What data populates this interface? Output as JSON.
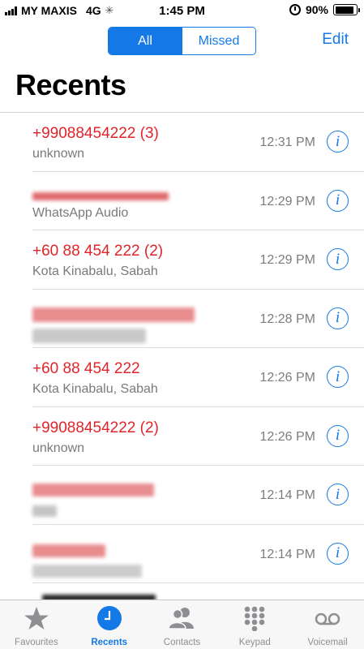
{
  "status_bar": {
    "carrier": "MY MAXIS",
    "network": "4G",
    "time": "1:45 PM",
    "battery": "90%",
    "battery_level": 0.9
  },
  "header": {
    "segments": [
      "All",
      "Missed"
    ],
    "selected_segment": "All",
    "edit_label": "Edit",
    "title": "Recents"
  },
  "calls": [
    {
      "caller": "+99088454222 (3)",
      "subtitle": "unknown",
      "time": "12:31 PM",
      "redacted": false
    },
    {
      "caller": "",
      "subtitle": "WhatsApp Audio",
      "time": "12:29 PM",
      "redacted": true
    },
    {
      "caller": "+60 88 454 222 (2)",
      "subtitle": "Kota Kinabalu, Sabah",
      "time": "12:29 PM",
      "redacted": false
    },
    {
      "caller": "",
      "subtitle": "",
      "time": "12:28 PM",
      "redacted": true
    },
    {
      "caller": "+60 88 454 222",
      "subtitle": "Kota Kinabalu, Sabah",
      "time": "12:26 PM",
      "redacted": false
    },
    {
      "caller": "+99088454222 (2)",
      "subtitle": "unknown",
      "time": "12:26 PM",
      "redacted": false
    },
    {
      "caller": "",
      "subtitle": "",
      "time": "12:14 PM",
      "redacted": true
    },
    {
      "caller": "",
      "subtitle": "",
      "time": "12:14 PM",
      "redacted": true
    }
  ],
  "info_glyph": "i",
  "colors": {
    "accent": "#1479e6",
    "missed_call": "#e0242b",
    "secondary_text": "#7a7a7a"
  },
  "tabs": [
    {
      "label": "Favourites",
      "icon": "star-icon",
      "active": false
    },
    {
      "label": "Recents",
      "icon": "clock-icon",
      "active": true
    },
    {
      "label": "Contacts",
      "icon": "contacts-icon",
      "active": false
    },
    {
      "label": "Keypad",
      "icon": "keypad-icon",
      "active": false
    },
    {
      "label": "Voicemail",
      "icon": "voicemail-icon",
      "active": false
    }
  ]
}
